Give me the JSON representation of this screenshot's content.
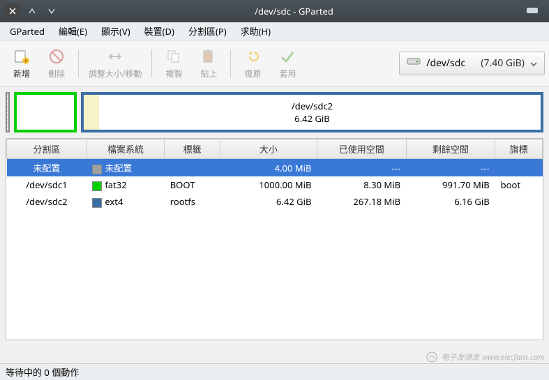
{
  "window": {
    "title": "/dev/sdc - GParted"
  },
  "menu": {
    "gparted": "GParted",
    "edit": "編輯(E)",
    "view": "顯示(V)",
    "device": "裝置(D)",
    "partition": "分割區(P)",
    "help": "求助(H)"
  },
  "toolbar": {
    "new": "新增",
    "delete": "刪除",
    "resize": "調整大小/移動",
    "copy": "複製",
    "paste": "貼上",
    "undo": "復原",
    "apply": "套用"
  },
  "device": {
    "name": "/dev/sdc",
    "size": "(7.40 GiB)"
  },
  "visual": {
    "main_label_name": "/dev/sdc2",
    "main_label_size": "6.42 GiB"
  },
  "columns": {
    "partition": "分割區",
    "filesystem": "檔案系統",
    "label": "標籤",
    "size": "大小",
    "used": "已使用空間",
    "unused": "剩餘空間",
    "flags": "旗標"
  },
  "rows": [
    {
      "partition": "未配置",
      "fs_color": "#a0a0a0",
      "filesystem": "未配置",
      "label": "",
      "size": "4.00 MiB",
      "used": "---",
      "unused": "---",
      "flags": "",
      "selected": true
    },
    {
      "partition": "/dev/sdc1",
      "fs_color": "#00d000",
      "filesystem": "fat32",
      "label": "BOOT",
      "size": "1000.00 MiB",
      "used": "8.30 MiB",
      "unused": "991.70 MiB",
      "flags": "boot",
      "selected": false
    },
    {
      "partition": "/dev/sdc2",
      "fs_color": "#3a6ea5",
      "filesystem": "ext4",
      "label": "rootfs",
      "size": "6.42 GiB",
      "used": "267.18 MiB",
      "unused": "6.16 GiB",
      "flags": "",
      "selected": false
    }
  ],
  "status": {
    "text": "等待中的 0 個動作"
  },
  "watermark": {
    "text": "www.elecfans.com",
    "brand": "电子发烧友"
  }
}
